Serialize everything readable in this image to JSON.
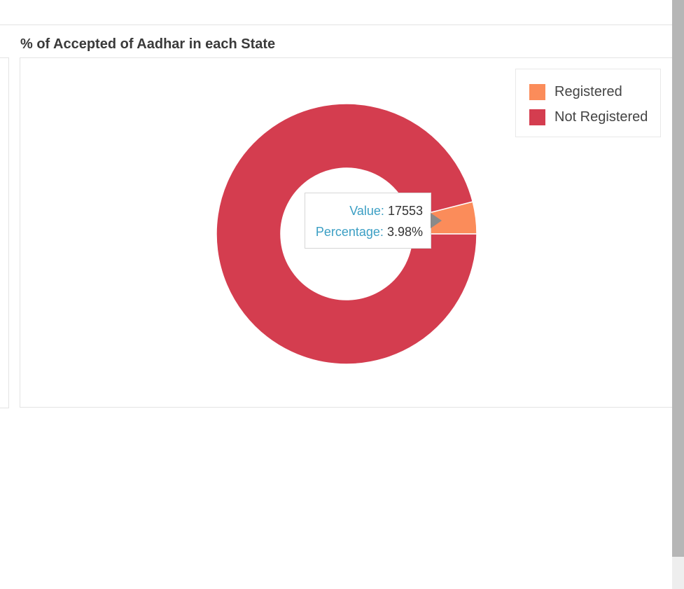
{
  "panel": {
    "title": "% of Accepted of Aadhar in each State"
  },
  "chart_data": {
    "type": "pie",
    "variant": "donut",
    "title": "% of Accepted of Aadhar in each State",
    "series": [
      {
        "name": "Registered",
        "value": 17553,
        "percentage": 3.98,
        "color": "#fb8c5a"
      },
      {
        "name": "Not Registered",
        "percentage": 96.02,
        "color": "#d43d4f"
      }
    ],
    "legend_position": "top-right",
    "tooltip": {
      "slice": "Registered",
      "value_label": "Value:",
      "value": "17553",
      "percentage_label": "Percentage:",
      "percentage": "3.98%"
    }
  },
  "colors": {
    "tooltip_key": "#3c9fc4",
    "tooltip_arrow": "#8a8a8a"
  }
}
